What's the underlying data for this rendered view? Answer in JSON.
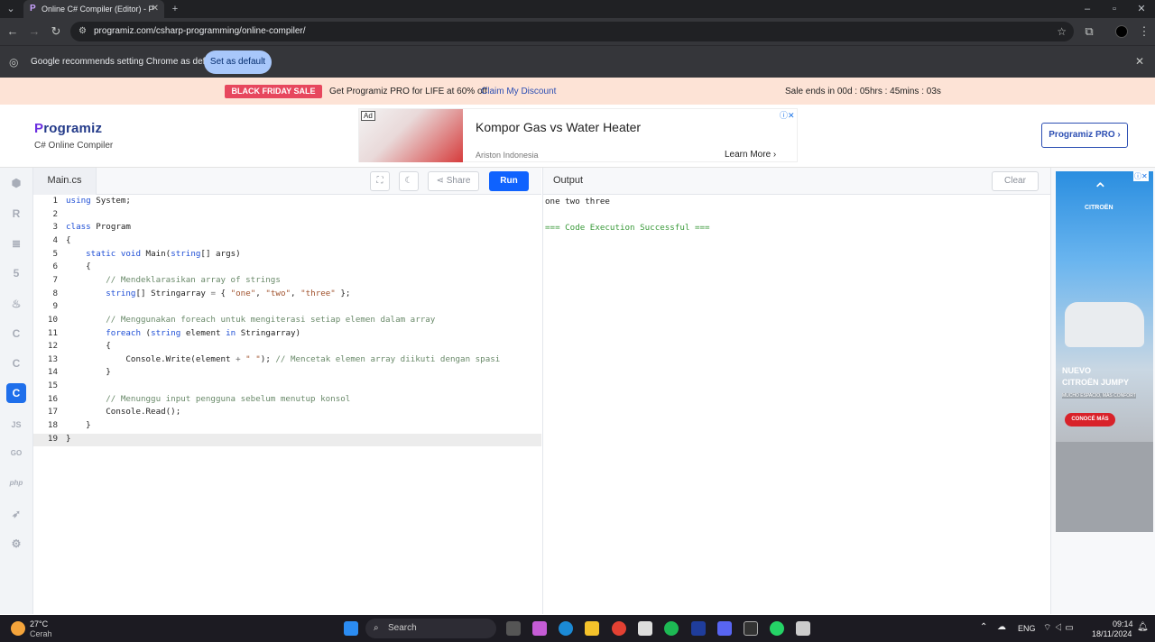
{
  "browser": {
    "tab_title": "Online C# Compiler (Editor) - P",
    "url": "programiz.com/csharp-programming/online-compiler/",
    "infobar_text": "Google recommends setting Chrome as default",
    "infobar_button": "Set as default"
  },
  "promo": {
    "badge": "BLACK FRIDAY SALE",
    "text": "Get Programiz PRO for LIFE at 60% off",
    "link": "Claim My Discount",
    "countdown": "Sale ends in 00d : 05hrs : 45mins : 03s"
  },
  "header": {
    "logo": "rogramiz",
    "logo_prefix": "P",
    "subtitle": "C# Online Compiler",
    "pro_button": "Programiz PRO ›"
  },
  "ad_banner": {
    "badge": "Ad",
    "headline": "Kompor Gas vs Water Heater",
    "advertiser": "Ariston Indonesia",
    "cta": "Learn More ›"
  },
  "editor": {
    "file_tab": "Main.cs",
    "share_label": "Share",
    "run_label": "Run",
    "lines": [
      {
        "n": "1",
        "parts": [
          [
            "kw",
            "using"
          ],
          [
            "",
            "System;"
          ]
        ]
      },
      {
        "n": "2",
        "parts": []
      },
      {
        "n": "3",
        "parts": [
          [
            "kw",
            "class"
          ],
          [
            "",
            "Program"
          ]
        ]
      },
      {
        "n": "4",
        "parts": [
          [
            "",
            "{"
          ]
        ]
      },
      {
        "n": "5",
        "parts": [
          [
            "",
            "    "
          ],
          [
            "kw",
            "static void"
          ],
          [
            "",
            " Main("
          ],
          [
            "kw",
            "string"
          ],
          [
            "",
            "[] args)"
          ]
        ]
      },
      {
        "n": "6",
        "parts": [
          [
            "",
            "    {"
          ]
        ]
      },
      {
        "n": "7",
        "parts": [
          [
            "",
            "        "
          ],
          [
            "cm",
            "// Mendeklarasikan array of strings"
          ]
        ]
      },
      {
        "n": "8",
        "parts": [
          [
            "",
            "        "
          ],
          [
            "kw",
            "string"
          ],
          [
            "",
            "[] Stringarray "
          ],
          [
            "op",
            "="
          ],
          [
            "",
            " { "
          ],
          [
            "st",
            "\"one\""
          ],
          [
            "",
            ", "
          ],
          [
            "st",
            "\"two\""
          ],
          [
            "",
            ", "
          ],
          [
            "st",
            "\"three\""
          ],
          [
            "",
            " };"
          ]
        ]
      },
      {
        "n": "9",
        "parts": []
      },
      {
        "n": "10",
        "parts": [
          [
            "",
            "        "
          ],
          [
            "cm",
            "// Menggunakan foreach untuk mengiterasi setiap elemen dalam array"
          ]
        ]
      },
      {
        "n": "11",
        "parts": [
          [
            "",
            "        "
          ],
          [
            "kw",
            "foreach"
          ],
          [
            "",
            " ("
          ],
          [
            "kw",
            "string"
          ],
          [
            "",
            " element "
          ],
          [
            "kw",
            "in"
          ],
          [
            "",
            " Stringarray)"
          ]
        ]
      },
      {
        "n": "12",
        "parts": [
          [
            "",
            "        {"
          ]
        ]
      },
      {
        "n": "13",
        "parts": [
          [
            "",
            "            Console.Write(element "
          ],
          [
            "op",
            "+"
          ],
          [
            "",
            " "
          ],
          [
            "st",
            "\" \""
          ],
          [
            "",
            "); "
          ],
          [
            "cm",
            "// Mencetak elemen array diikuti dengan spasi"
          ]
        ]
      },
      {
        "n": "14",
        "parts": [
          [
            "",
            "        }"
          ]
        ]
      },
      {
        "n": "15",
        "parts": []
      },
      {
        "n": "16",
        "parts": [
          [
            "",
            "        "
          ],
          [
            "cm",
            "// Menunggu input pengguna sebelum menutup konsol"
          ]
        ]
      },
      {
        "n": "17",
        "parts": [
          [
            "",
            "        Console.Read();"
          ]
        ]
      },
      {
        "n": "18",
        "parts": [
          [
            "",
            "    }"
          ]
        ]
      },
      {
        "n": "19",
        "parts": [
          [
            "",
            "}"
          ]
        ]
      }
    ]
  },
  "output": {
    "title": "Output",
    "clear_label": "Clear",
    "line1": "one two three",
    "line2": "=== Code Execution Successful ==="
  },
  "rail_items": [
    "python",
    "r",
    "sql",
    "html",
    "java",
    "c",
    "cpp",
    "csharp",
    "js",
    "go",
    "php",
    "swift",
    "rust"
  ],
  "right_ad": {
    "brand": "CITROËN",
    "title1": "NUEVO",
    "title2": "CITROËN JUMPY",
    "tagline": "MUCHO ESPACIO, MÁS CONFORT",
    "cta": "CONOCÉ MÁS"
  },
  "taskbar": {
    "weather_temp": "27°C",
    "weather_desc": "Cerah",
    "search": "Search",
    "lang": "ENG",
    "time": "09:14",
    "date": "18/11/2024"
  }
}
